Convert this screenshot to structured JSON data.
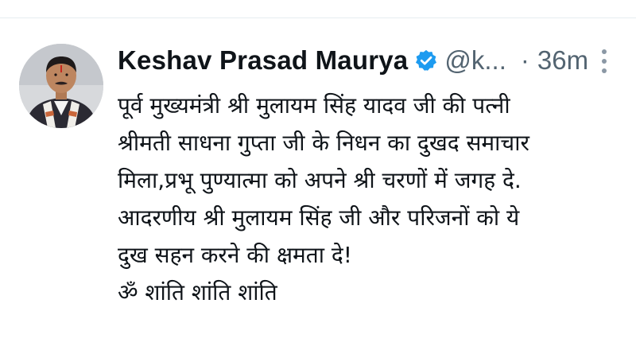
{
  "tweet": {
    "author": {
      "display_name": "Keshav Prasad Maurya",
      "handle": "@k...",
      "verified": true,
      "verified_icon": "verified-badge-icon",
      "avatar_icon": "profile-photo"
    },
    "separator": "·",
    "timestamp": "36m",
    "more_icon": "more-options-icon",
    "text_lines": [
      "पूर्व मुख्यमंत्री श्री मुलायम सिंह यादव जी की पत्नी",
      "श्रीमती साधना गुप्ता जी के निधन का दुखद समाचार",
      "मिला,प्रभू पुण्यात्मा को अपने श्री चरणों में जगह दे.",
      "आदरणीय श्री मुलायम सिंह जी और परिजनों को ये",
      "दुख सहन करने की क्षमता दे!",
      "ॐ शांति शांति शांति"
    ]
  },
  "colors": {
    "text": "#0f1419",
    "secondary_text": "#536471",
    "verified_blue": "#1d9bf0",
    "divider": "#e6ecf0"
  }
}
